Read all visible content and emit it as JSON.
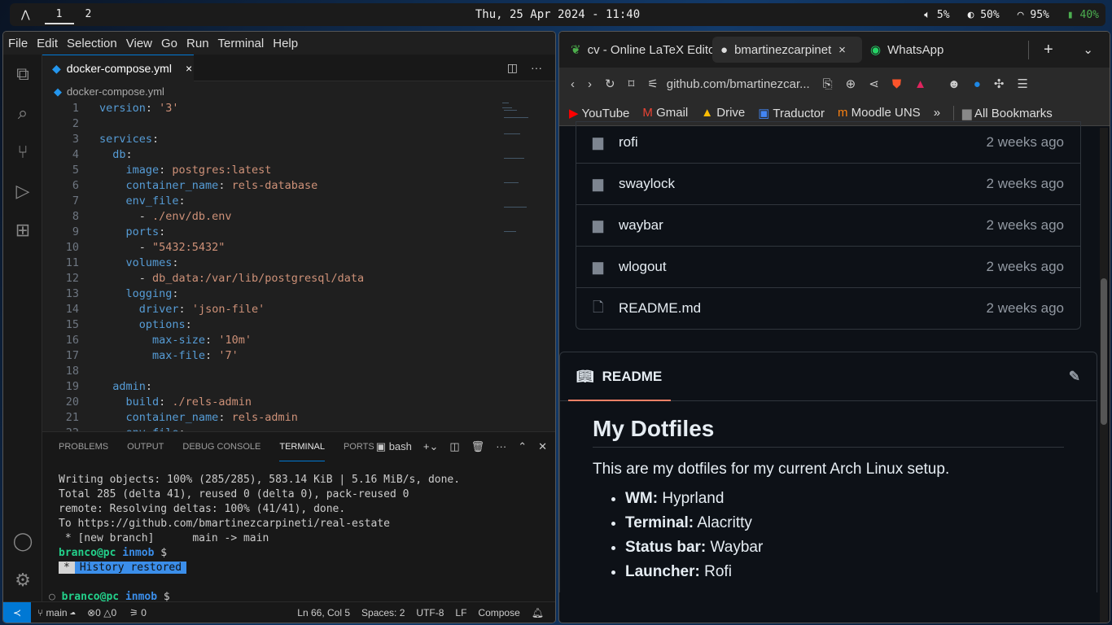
{
  "topbar": {
    "workspaces": [
      "1",
      "2"
    ],
    "clock": "Thu, 25 Apr 2024 - 11:40",
    "volume": "5%",
    "brightness": "50%",
    "wifi": "95%",
    "battery": "40%",
    "battery_color": "#4caf50"
  },
  "vscode": {
    "menu": [
      "File",
      "Edit",
      "Selection",
      "View",
      "Go",
      "Run",
      "Terminal",
      "Help"
    ],
    "tab": "docker-compose.yml",
    "breadcrumb": "docker-compose.yml",
    "code": [
      [
        {
          "t": "version",
          "c": "k"
        },
        {
          "t": ": ",
          "c": "p"
        },
        {
          "t": "'3'",
          "c": "s"
        }
      ],
      [],
      [
        {
          "t": "services",
          "c": "k"
        },
        {
          "t": ":",
          "c": "p"
        }
      ],
      [
        {
          "t": "  db",
          "c": "k"
        },
        {
          "t": ":",
          "c": "p"
        }
      ],
      [
        {
          "t": "    image",
          "c": "k"
        },
        {
          "t": ": ",
          "c": "p"
        },
        {
          "t": "postgres:latest",
          "c": "s"
        }
      ],
      [
        {
          "t": "    container_name",
          "c": "k"
        },
        {
          "t": ": ",
          "c": "p"
        },
        {
          "t": "rels-database",
          "c": "s"
        }
      ],
      [
        {
          "t": "    env_file",
          "c": "k"
        },
        {
          "t": ":",
          "c": "p"
        }
      ],
      [
        {
          "t": "      - ",
          "c": "p"
        },
        {
          "t": "./env/db.env",
          "c": "s"
        }
      ],
      [
        {
          "t": "    ports",
          "c": "k"
        },
        {
          "t": ":",
          "c": "p"
        }
      ],
      [
        {
          "t": "      - ",
          "c": "p"
        },
        {
          "t": "\"5432:5432\"",
          "c": "s"
        }
      ],
      [
        {
          "t": "    volumes",
          "c": "k"
        },
        {
          "t": ":",
          "c": "p"
        }
      ],
      [
        {
          "t": "      - ",
          "c": "p"
        },
        {
          "t": "db_data:/var/lib/postgresql/data",
          "c": "s"
        }
      ],
      [
        {
          "t": "    logging",
          "c": "k"
        },
        {
          "t": ":",
          "c": "p"
        }
      ],
      [
        {
          "t": "      driver",
          "c": "k"
        },
        {
          "t": ": ",
          "c": "p"
        },
        {
          "t": "'json-file'",
          "c": "s"
        }
      ],
      [
        {
          "t": "      options",
          "c": "k"
        },
        {
          "t": ":",
          "c": "p"
        }
      ],
      [
        {
          "t": "        max-size",
          "c": "k"
        },
        {
          "t": ": ",
          "c": "p"
        },
        {
          "t": "'10m'",
          "c": "s"
        }
      ],
      [
        {
          "t": "        max-file",
          "c": "k"
        },
        {
          "t": ": ",
          "c": "p"
        },
        {
          "t": "'7'",
          "c": "s"
        }
      ],
      [],
      [
        {
          "t": "  admin",
          "c": "k"
        },
        {
          "t": ":",
          "c": "p"
        }
      ],
      [
        {
          "t": "    build",
          "c": "k"
        },
        {
          "t": ": ",
          "c": "p"
        },
        {
          "t": "./rels-admin",
          "c": "s"
        }
      ],
      [
        {
          "t": "    container_name",
          "c": "k"
        },
        {
          "t": ": ",
          "c": "p"
        },
        {
          "t": "rels-admin",
          "c": "s"
        }
      ],
      [
        {
          "t": "    env_file",
          "c": "k"
        },
        {
          "t": ":",
          "c": "p"
        }
      ]
    ],
    "panel_tabs": [
      "PROBLEMS",
      "OUTPUT",
      "DEBUG CONSOLE",
      "TERMINAL",
      "PORTS"
    ],
    "shell": "bash",
    "terminal": {
      "lines": [
        "Writing objects: 100% (285/285), 583.14 KiB | 5.16 MiB/s, done.",
        "Total 285 (delta 41), reused 0 (delta 0), pack-reused 0",
        "remote: Resolving deltas: 100% (41/41), done.",
        "To https://github.com/bmartinezcarpineti/real-estate",
        " * [new branch]      main -> main"
      ],
      "user": "branco@pc",
      "dir": "inmob",
      "prompt": "$",
      "hist_star": "*",
      "hist": "History restored"
    },
    "status": {
      "branch": "main",
      "errors": "0",
      "warnings": "0",
      "ports": "0",
      "position": "Ln 66, Col 5",
      "spaces": "Spaces: 2",
      "encoding": "UTF-8",
      "eol": "LF",
      "language": "Compose"
    }
  },
  "browser": {
    "tabs": [
      "cv - Online LaTeX Editor",
      "bmartinezcarpineti",
      "WhatsApp"
    ],
    "url": "github.com/bmartinezcar...",
    "bookmarks": [
      "YouTube",
      "Gmail",
      "Drive",
      "Traductor",
      "Moodle UNS"
    ],
    "all_bookmarks": "All Bookmarks",
    "files": [
      {
        "name": "rofi",
        "type": "folder",
        "date": "2 weeks ago"
      },
      {
        "name": "swaylock",
        "type": "folder",
        "date": "2 weeks ago"
      },
      {
        "name": "waybar",
        "type": "folder",
        "date": "2 weeks ago"
      },
      {
        "name": "wlogout",
        "type": "folder",
        "date": "2 weeks ago"
      },
      {
        "name": "README.md",
        "type": "file",
        "date": "2 weeks ago"
      }
    ],
    "readme": {
      "tab": "README",
      "title": "My Dotfiles",
      "intro": "This are my dotfiles for my current Arch Linux setup.",
      "items": [
        {
          "k": "WM:",
          "v": "Hyprland"
        },
        {
          "k": "Terminal:",
          "v": "Alacritty"
        },
        {
          "k": "Status bar:",
          "v": "Waybar"
        },
        {
          "k": "Launcher:",
          "v": "Rofi"
        }
      ]
    }
  }
}
